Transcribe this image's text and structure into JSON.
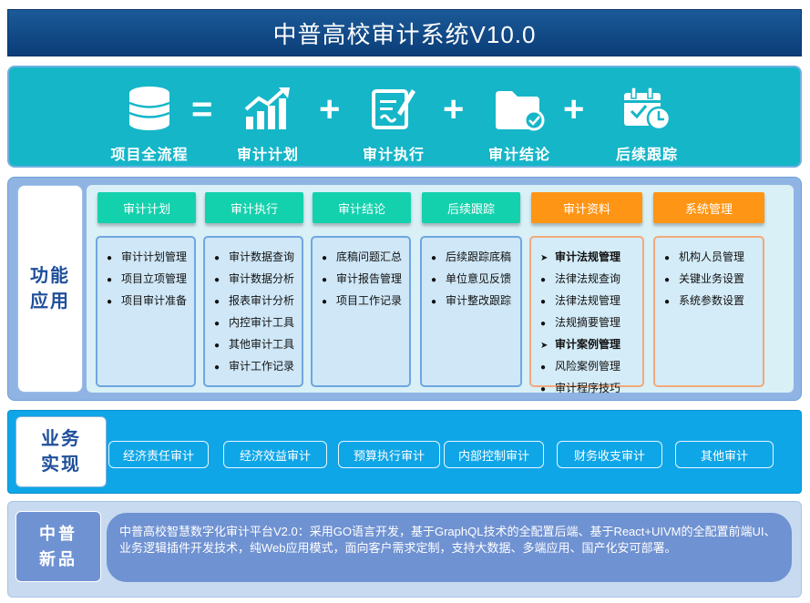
{
  "title": "中普高校审计系统V10.0",
  "flow": {
    "items": [
      {
        "label": "项目全流程",
        "icon": "database-icon"
      },
      {
        "label": "审计计划",
        "icon": "bar-chart-icon"
      },
      {
        "label": "审计执行",
        "icon": "edit-document-icon"
      },
      {
        "label": "审计结论",
        "icon": "folder-check-icon"
      },
      {
        "label": "后续跟踪",
        "icon": "calendar-clock-icon"
      }
    ],
    "operators": [
      "=",
      "+",
      "+",
      "+"
    ]
  },
  "functions": {
    "label": "功能应用",
    "modules": [
      {
        "title": "审计计划",
        "color": "#14d1ad",
        "items": [
          "审计计划管理",
          "项目立项管理",
          "项目审计准备"
        ]
      },
      {
        "title": "审计执行",
        "color": "#14d1ad",
        "items": [
          "审计数据查询",
          "审计数据分析",
          "报表审计分析",
          "内控审计工具",
          "其他审计工具",
          "审计工作记录"
        ]
      },
      {
        "title": "审计结论",
        "color": "#14d1ad",
        "items": [
          "底稿问题汇总",
          "审计报告管理",
          "项目工作记录"
        ]
      },
      {
        "title": "后续跟踪",
        "color": "#14d1ad",
        "items": [
          "后续跟踪底稿",
          "单位意见反馈",
          "审计整改跟踪"
        ]
      },
      {
        "title": "审计资料",
        "color": "#ff9515",
        "items": [
          "审计法规管理",
          "法律法规查询",
          "法律法规管理",
          "法规摘要管理",
          "审计案例管理",
          "风险案例管理",
          "审计程序技巧"
        ]
      },
      {
        "title": "系统管理",
        "color": "#ff9515",
        "items": [
          "机构人员管理",
          "关键业务设置",
          "系统参数设置"
        ]
      }
    ]
  },
  "business": {
    "label": "业务实现",
    "buttons": [
      "经济责任审计",
      "经济效益审计",
      "预算执行审计",
      "内部控制审计",
      "财务收支审计",
      "其他审计"
    ]
  },
  "product": {
    "label": "中普新品",
    "description": "中普高校智慧数字化审计平台V2.0：采用GO语言开发，基于GraphQL技术的全配置后端、基于React+UIVM的全配置前端UI、业务逻辑插件开发技术，纯Web应用模式，面向客户需求定制，支持大数据、多端应用、国产化安可部署。"
  }
}
